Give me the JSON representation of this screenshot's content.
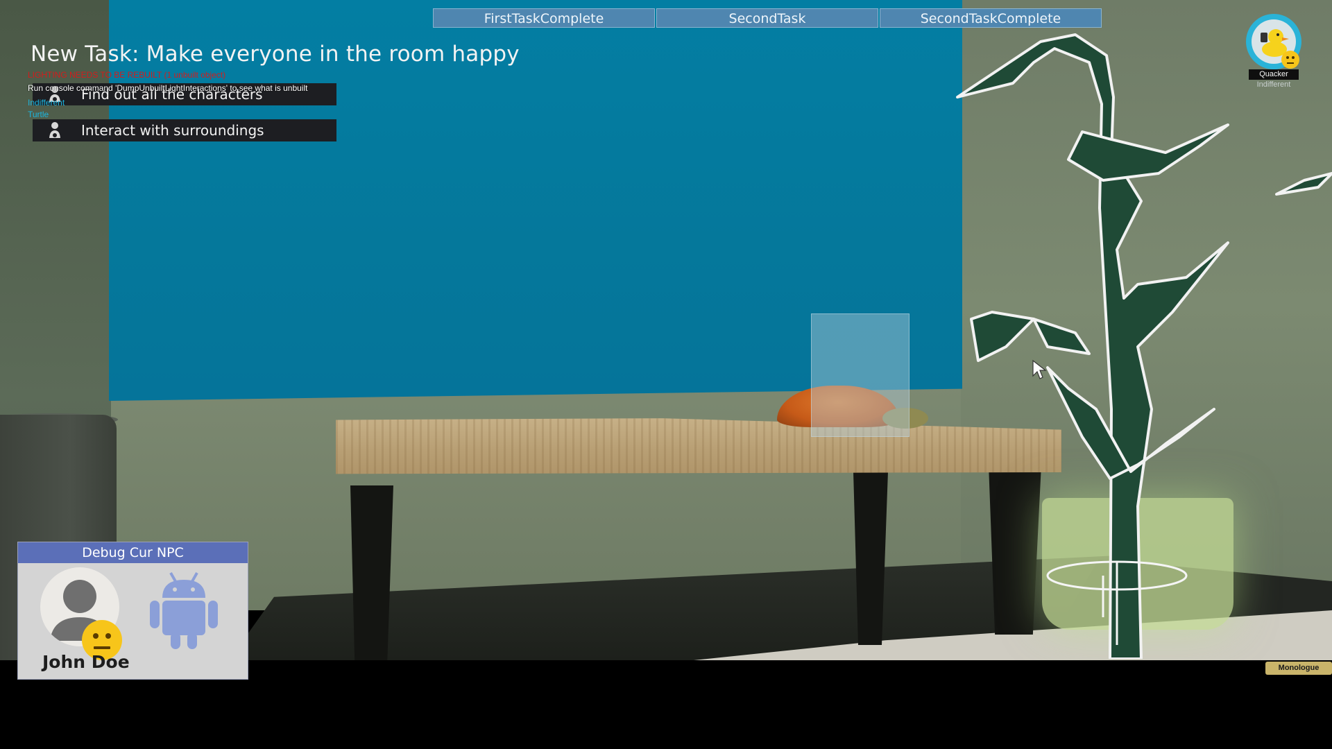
{
  "top_tabs": [
    {
      "label": "FirstTaskComplete"
    },
    {
      "label": "SecondTask"
    },
    {
      "label": "SecondTaskComplete"
    }
  ],
  "task": {
    "title": "New Task: Make everyone in the room happy",
    "items": [
      {
        "label": "Find out all the characters",
        "icon": "character-icon"
      },
      {
        "label": "Interact with surroundings",
        "icon": "character-icon"
      }
    ]
  },
  "debug_overlay": {
    "lighting_warning": "LIGHTING NEEDS TO BE REBUILT (1 unbuilt object)",
    "console_hint": "Run console command 'DumpUnbuiltLightInteractions' to see what is unbuilt",
    "mood": "Indifferent",
    "target": "Turtle"
  },
  "npc_badge": {
    "name": "Quacker",
    "mood": "Indifferent",
    "icon": "duck-avatar-icon",
    "mood_icon": "neutral-face-icon"
  },
  "debug_panel": {
    "header": "Debug Cur NPC",
    "name": "John Doe",
    "portrait_icon": "user-silhouette-icon",
    "mood_icon": "neutral-face-icon",
    "robot_icon": "android-robot-icon"
  },
  "monologue_button": {
    "label": "Monologue"
  },
  "colors": {
    "tab_bg": "#4f86b0",
    "panel_header": "#5b6fb8",
    "warning_red": "#d41c1c",
    "debug_cyan": "#1bb6e0",
    "avatar_ring": "#2ab3d8",
    "monologue_bg": "#c9b46a",
    "wall_blue": "#037ea3"
  }
}
